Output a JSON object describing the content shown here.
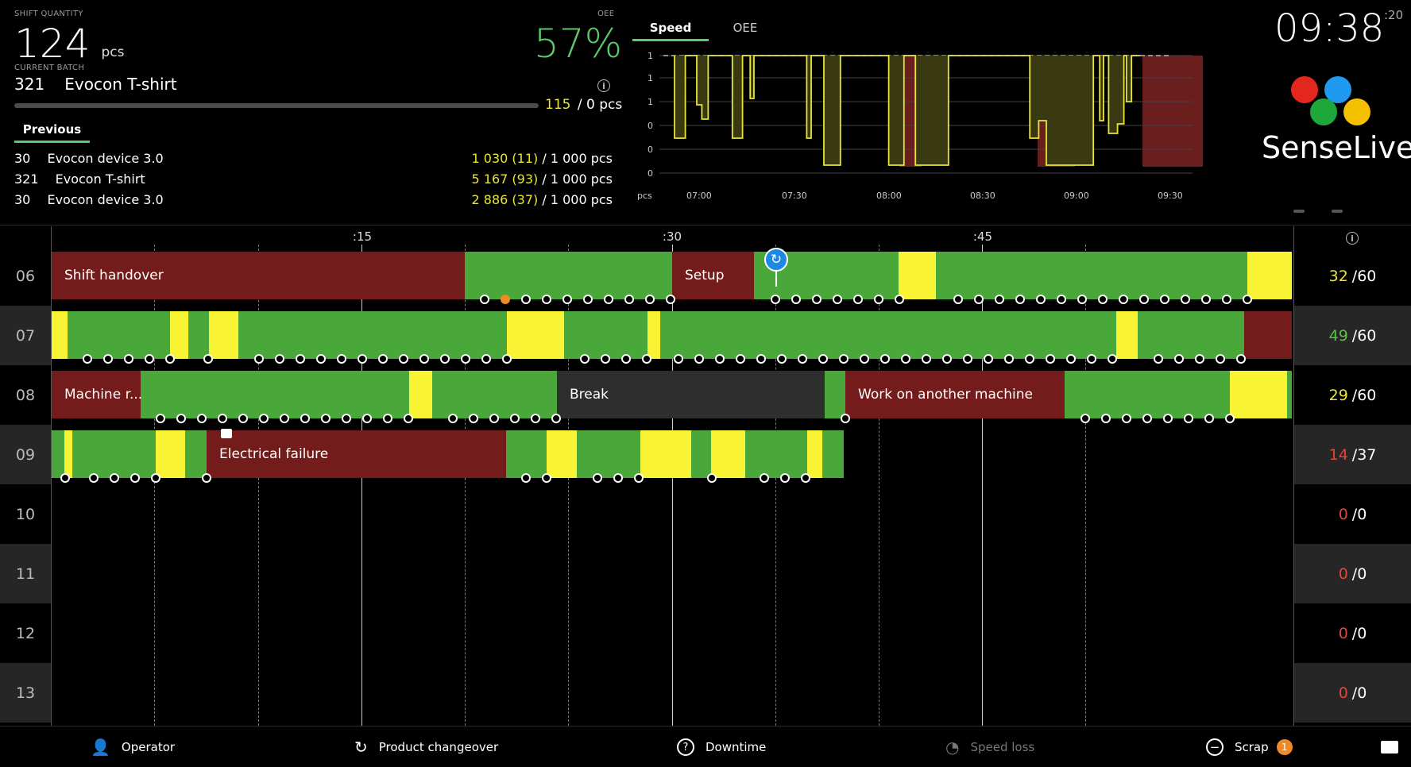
{
  "header": {
    "shift_quantity_label": "SHIFT QUANTITY",
    "shift_quantity": "124",
    "shift_quantity_unit": "pcs",
    "current_batch_label": "CURRENT BATCH",
    "batch_id": "321",
    "batch_name": "Evocon T-shirt",
    "oee_label": "OEE",
    "oee_value": "57%",
    "batch_progress_done": "115",
    "batch_progress_total": "/ 0 pcs",
    "previous_tab": "Previous",
    "previous_batches": [
      {
        "id": "30",
        "name": "Evocon device 3.0",
        "count": "1 030 (11)",
        "target": "/ 1 000 pcs"
      },
      {
        "id": "321",
        "name": "Evocon T-shirt",
        "count": "5 167 (93)",
        "target": "/ 1 000 pcs"
      },
      {
        "id": "30",
        "name": "Evocon device 3.0",
        "count": "2 886 (37)",
        "target": "/ 1 000 pcs"
      }
    ]
  },
  "speed_chart": {
    "tabs": [
      "Speed",
      "OEE"
    ],
    "active_tab": "Speed",
    "y_unit": "pcs",
    "y_ticks": [
      "1",
      "1",
      "1",
      "0",
      "0",
      "0"
    ],
    "x_ticks": [
      "07:00",
      "07:30",
      "08:00",
      "08:30",
      "09:00",
      "09:30"
    ],
    "line_color": "#e8e43a",
    "fill_color": "#3a3a12",
    "stop_color": "#6a1e1e"
  },
  "clock": {
    "time": "09:38",
    "seconds": ":20"
  },
  "brand": {
    "name": "SenseLive",
    "dot_colors": [
      "#e3261e",
      "#1e9bf0",
      "#1fa83a",
      "#f5c000"
    ]
  },
  "timeline": {
    "quarter_labels": [
      ":15",
      ":30",
      ":45"
    ],
    "colors": {
      "running": "#4aa83a",
      "slow": "#f8f333",
      "stop": "#741b1b",
      "planned": "#2e2e2e"
    },
    "rows": [
      {
        "hour": "06",
        "count": "32",
        "target": "/60",
        "count_color": "#e8e43a",
        "segments": [
          {
            "label": "Shift handover"
          },
          {
            "label": "Setup"
          }
        ]
      },
      {
        "hour": "07",
        "count": "49",
        "target": "/60",
        "count_color": "#5ec04a"
      },
      {
        "hour": "08",
        "count": "29",
        "target": "/60",
        "count_color": "#e8e43a",
        "segments": [
          {
            "label": "Machine r..."
          },
          {
            "label": "Break"
          },
          {
            "label": "Work on another machine"
          }
        ]
      },
      {
        "hour": "09",
        "count": "14",
        "target": "/37",
        "count_color": "#e2453c",
        "segments": [
          {
            "label": "Electrical failure"
          }
        ]
      },
      {
        "hour": "10",
        "count": "0",
        "target": "/0",
        "count_color": "#e2453c"
      },
      {
        "hour": "11",
        "count": "0",
        "target": "/0",
        "count_color": "#e2453c"
      },
      {
        "hour": "12",
        "count": "0",
        "target": "/0",
        "count_color": "#e2453c"
      },
      {
        "hour": "13",
        "count": "0",
        "target": "/0",
        "count_color": "#e2453c"
      }
    ]
  },
  "footer": {
    "operator": "Operator",
    "product_changeover": "Product changeover",
    "downtime": "Downtime",
    "speed_loss": "Speed loss",
    "scrap": "Scrap",
    "scrap_badge": "1"
  }
}
